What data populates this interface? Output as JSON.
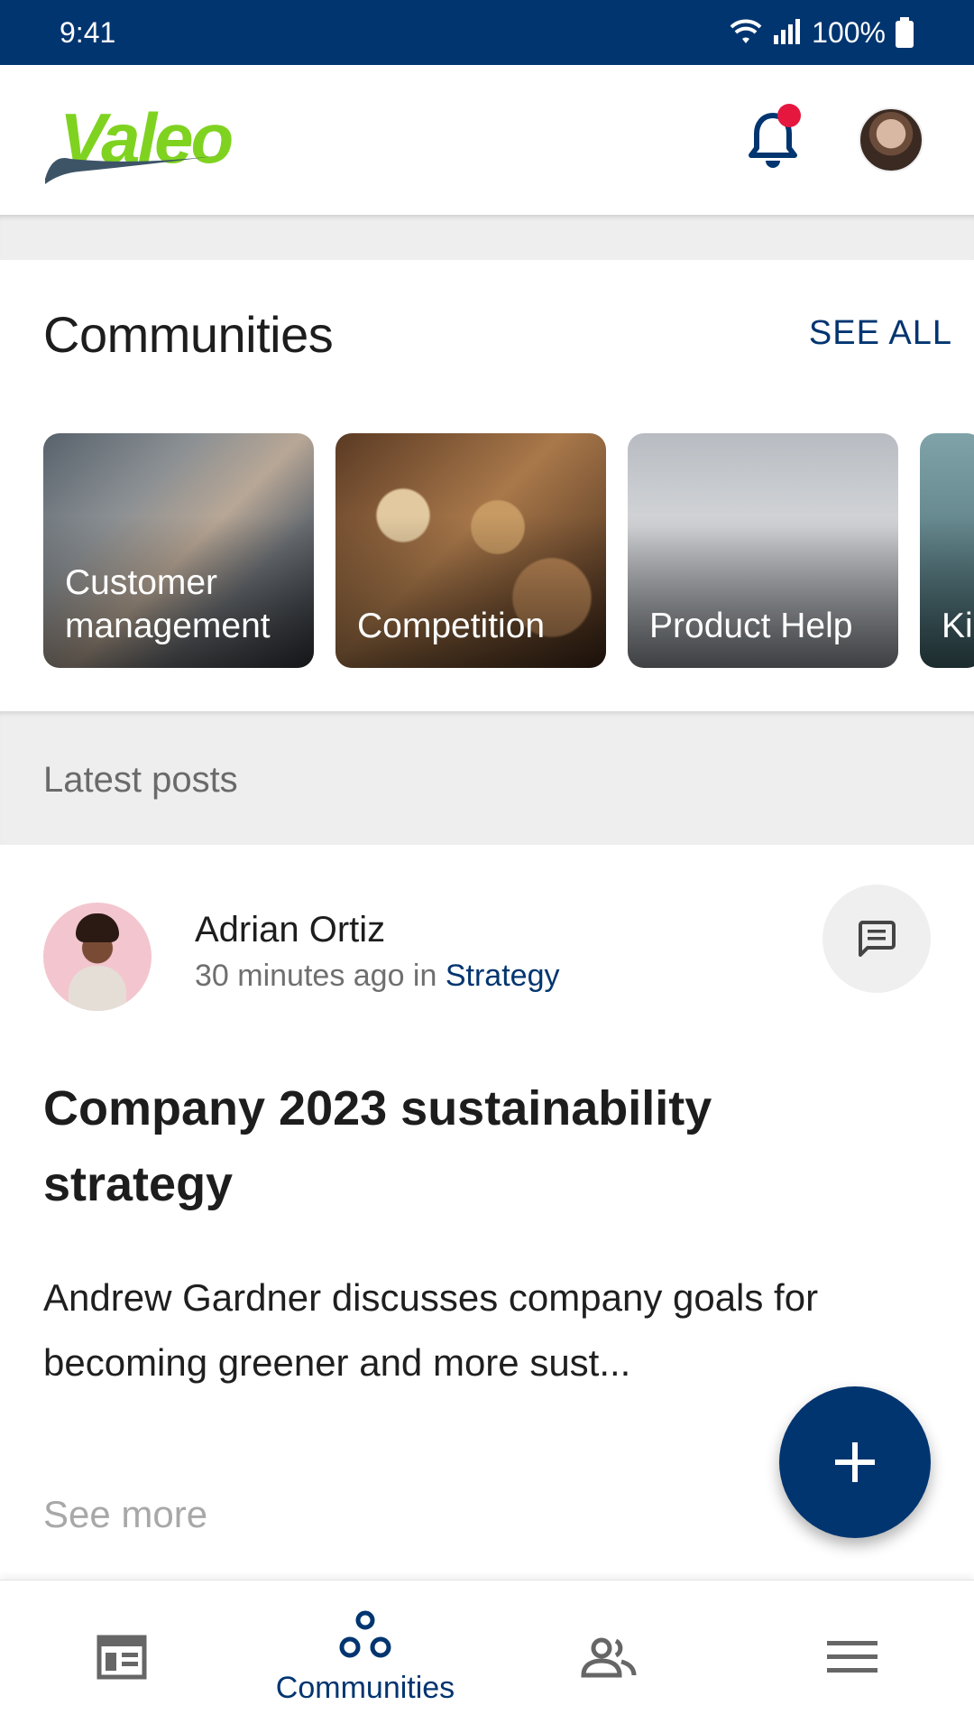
{
  "status_bar": {
    "time": "9:41",
    "battery": "100%",
    "icons": [
      "wifi-icon",
      "signal-icon",
      "battery-icon"
    ]
  },
  "header": {
    "logo_text": "Valeo",
    "notification_unread": true,
    "icons": [
      "bell-icon",
      "avatar"
    ]
  },
  "communities": {
    "title": "Communities",
    "see_all_label": "SEE ALL",
    "cards": [
      {
        "label": "Customer\nmanagement"
      },
      {
        "label": "Competition"
      },
      {
        "label": "Product Help"
      },
      {
        "label": "Ki"
      }
    ]
  },
  "latest_posts": {
    "title": "Latest posts"
  },
  "post": {
    "author": "Adrian Ortiz",
    "time_ago": "30 minutes ago in",
    "community": "Strategy",
    "title": "Company 2023 sustainability strategy",
    "excerpt": "Andrew Gardner discusses company goals for becoming greener and more sust...",
    "see_more_label": "See more",
    "comment_icon": "comment-icon"
  },
  "fab": {
    "icon": "plus-icon"
  },
  "bottom_nav": {
    "items": [
      {
        "icon": "feed-icon",
        "label": ""
      },
      {
        "icon": "communities-icon",
        "label": "Communities",
        "active": true
      },
      {
        "icon": "people-icon",
        "label": ""
      },
      {
        "icon": "menu-icon",
        "label": ""
      }
    ]
  },
  "colors": {
    "primary": "#013570",
    "logo_green": "#7fd320",
    "badge_red": "#e5173f",
    "background_gray": "#eeeeee"
  }
}
